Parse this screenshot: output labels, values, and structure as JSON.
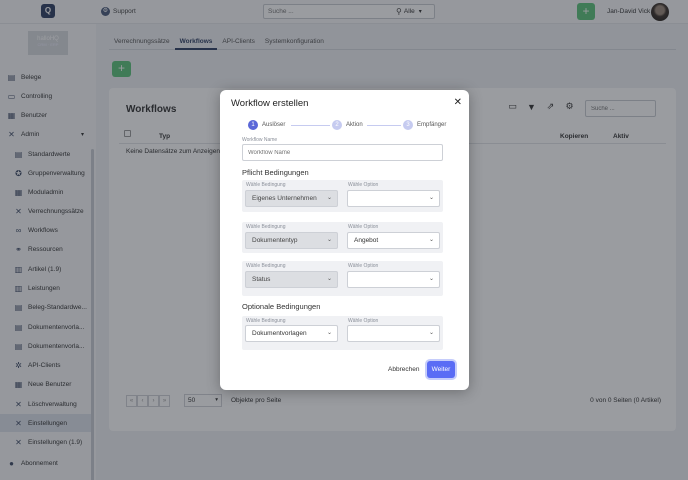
{
  "header": {
    "logo": "Q",
    "support_label": "Support",
    "search_placeholder": "Suche ...",
    "search_scope": "Alle",
    "user_name": "Jan-David Vick"
  },
  "sidebar": {
    "brand": "hallo",
    "brand_accent": "HQ",
    "brand_sub": "CRM · ERP",
    "items": [
      {
        "label": "Belege"
      },
      {
        "label": "Controlling"
      },
      {
        "label": "Benutzer"
      },
      {
        "label": "Admin"
      },
      {
        "label": "Standardwerte"
      },
      {
        "label": "Gruppenverwaltung"
      },
      {
        "label": "Moduladmin"
      },
      {
        "label": "Verrechnungssätze"
      },
      {
        "label": "Workflows"
      },
      {
        "label": "Ressourcen"
      },
      {
        "label": "Artikel (1.9)"
      },
      {
        "label": "Leistungen"
      },
      {
        "label": "Beleg-Standardwe..."
      },
      {
        "label": "Dokumentenvorla..."
      },
      {
        "label": "Dokumentenvorla..."
      },
      {
        "label": "API-Clients"
      },
      {
        "label": "Neue Benutzer"
      },
      {
        "label": "Löschverwaltung"
      },
      {
        "label": "Einstellungen"
      },
      {
        "label": "Einstellungen (1.9)"
      },
      {
        "label": "Abonnement"
      }
    ]
  },
  "tabs": [
    {
      "label": "Verrechnungssätze"
    },
    {
      "label": "Workflows"
    },
    {
      "label": "API-Clients"
    },
    {
      "label": "Systemkonfiguration"
    }
  ],
  "card": {
    "title": "Workflows",
    "search_placeholder": "Suche ...",
    "columns": {
      "type": "Typ",
      "copy": "Kopieren",
      "active": "Aktiv"
    },
    "empty_text": "Keine Datensätze zum Anzeigen",
    "page_size": "50",
    "per_page_label": "Objekte pro Seite",
    "page_info": "0 von 0 Seiten (0 Artikel)"
  },
  "modal": {
    "title": "Workflow erstellen",
    "steps": [
      {
        "num": "1",
        "label": "Auslöser"
      },
      {
        "num": "2",
        "label": "Aktion"
      },
      {
        "num": "3",
        "label": "Empfänger"
      }
    ],
    "name_label": "Workflow Name",
    "name_placeholder": "Workflow Name",
    "required_title": "Pflicht Bedingungen",
    "optional_title": "Optionale Bedingungen",
    "condition_label": "Wähle Bedingung",
    "option_label": "Wähle Option",
    "required_rows": [
      {
        "condition": "Eigenes Unternehmen",
        "option": ""
      },
      {
        "condition": "Dokumententyp",
        "option": "Angebot"
      },
      {
        "condition": "Status",
        "option": ""
      }
    ],
    "optional_rows": [
      {
        "condition": "Dokumentvorlagen",
        "option": ""
      }
    ],
    "cancel_label": "Abbrechen",
    "next_label": "Weiter"
  },
  "colors": {
    "primary": "#5a6cf5",
    "green": "#5cc47a",
    "navy": "#2f3f63"
  }
}
